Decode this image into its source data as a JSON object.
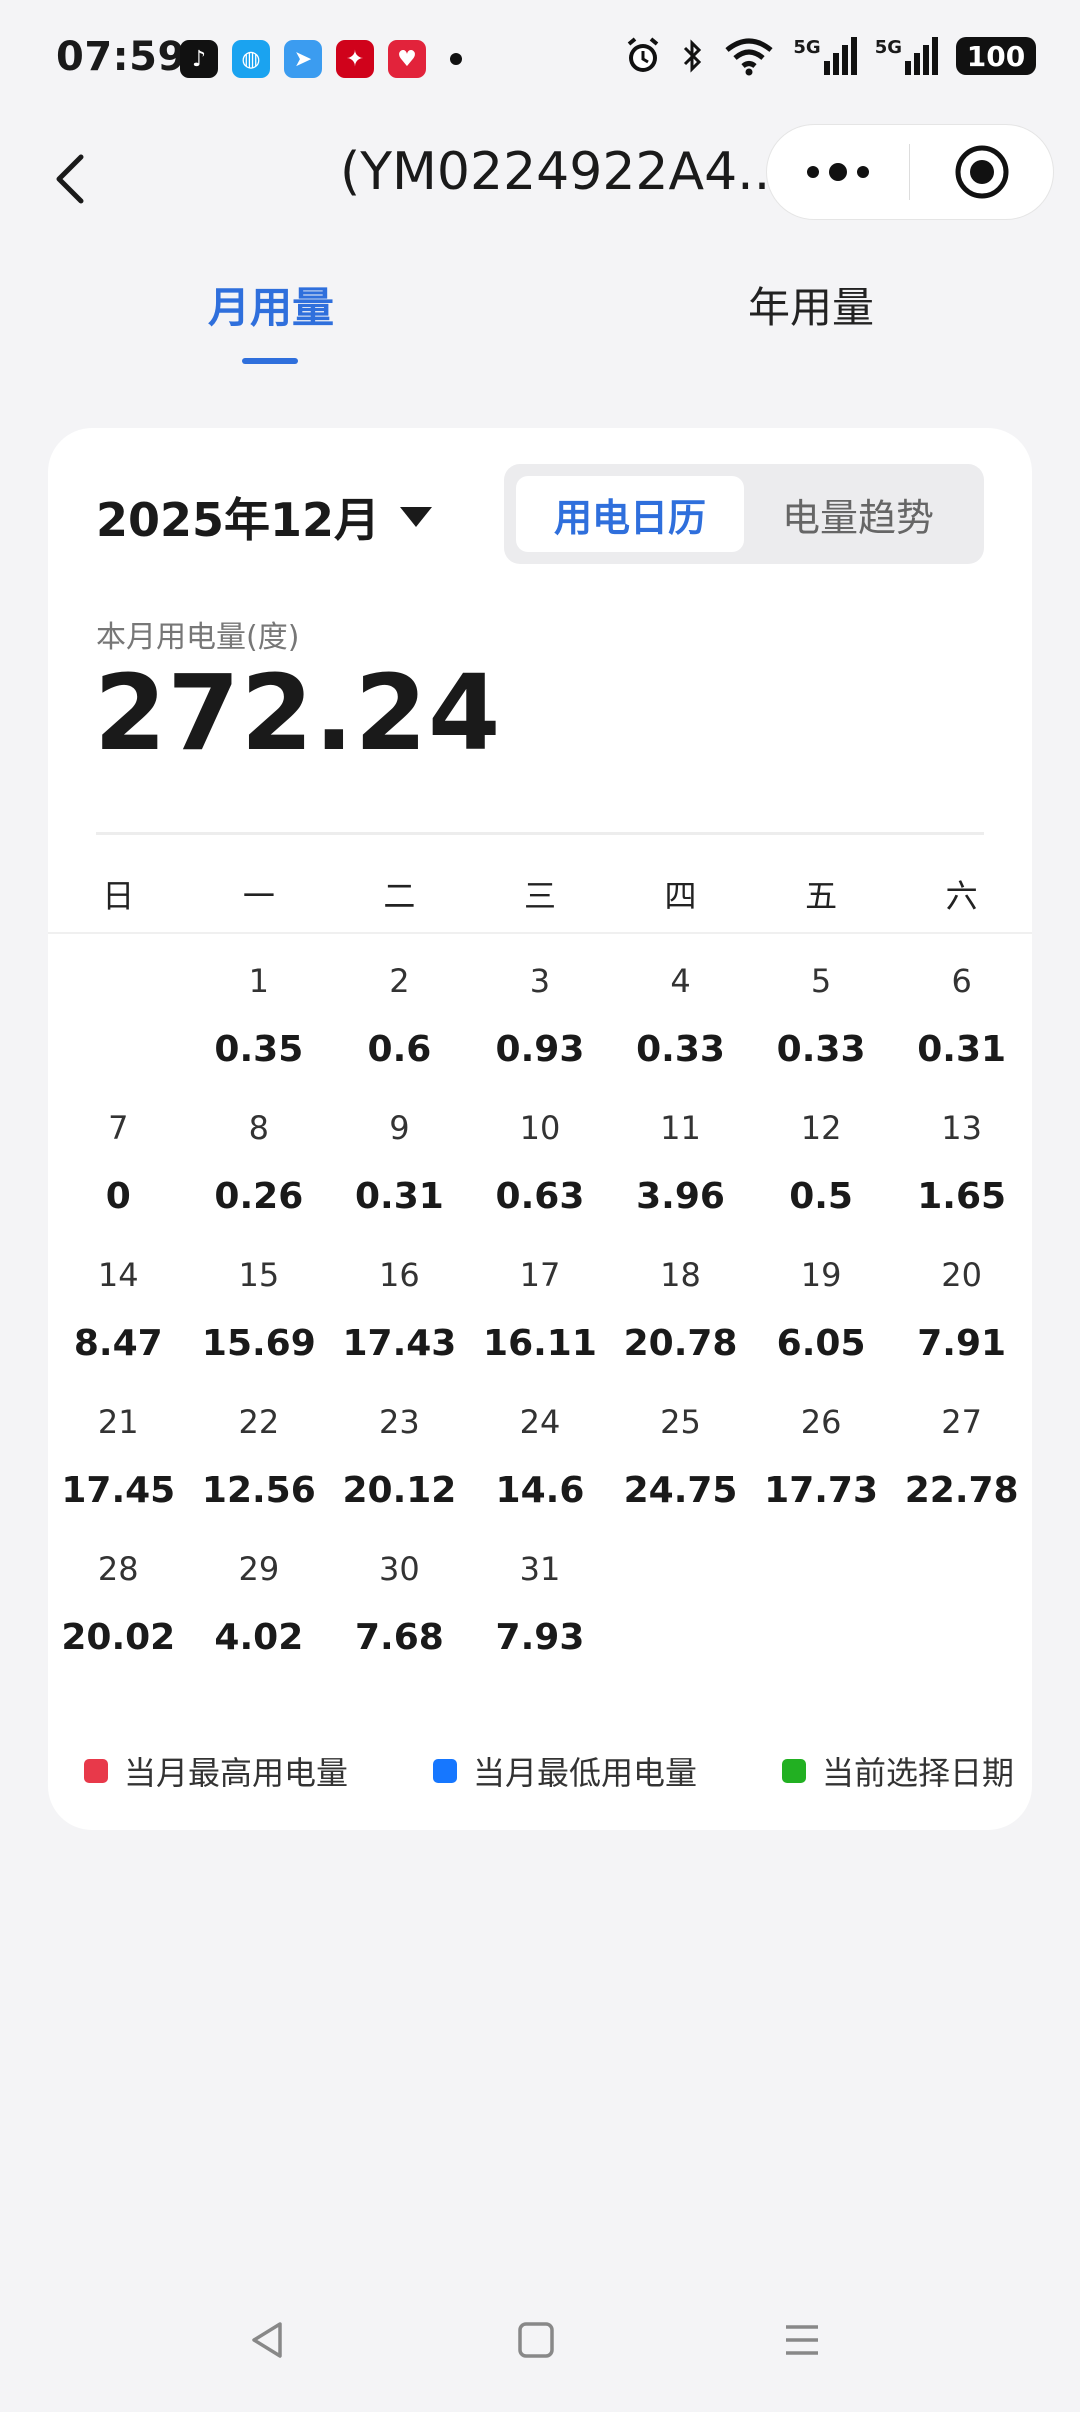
{
  "status_bar": {
    "time": "07:59",
    "battery": "100",
    "signal_label_1": "5G",
    "signal_label_2": "5G"
  },
  "header": {
    "title": "(YM0224922A4...",
    "back_label": "back"
  },
  "tabs": [
    {
      "label": "月用量",
      "active": true
    },
    {
      "label": "年用量",
      "active": false
    }
  ],
  "card": {
    "month": "2025年12月",
    "segments": [
      {
        "label": "用电日历",
        "active": true
      },
      {
        "label": "电量趋势",
        "active": false
      }
    ],
    "usage_label": "本月用电量(度)",
    "usage_value": "272.24"
  },
  "calendar": {
    "weekdays": [
      "日",
      "一",
      "二",
      "三",
      "四",
      "五",
      "六"
    ],
    "weeks": [
      [
        null,
        {
          "day": "1",
          "value": "0.35"
        },
        {
          "day": "2",
          "value": "0.6"
        },
        {
          "day": "3",
          "value": "0.93"
        },
        {
          "day": "4",
          "value": "0.33"
        },
        {
          "day": "5",
          "value": "0.33"
        },
        {
          "day": "6",
          "value": "0.31"
        }
      ],
      [
        {
          "day": "7",
          "value": "0"
        },
        {
          "day": "8",
          "value": "0.26"
        },
        {
          "day": "9",
          "value": "0.31"
        },
        {
          "day": "10",
          "value": "0.63"
        },
        {
          "day": "11",
          "value": "3.96"
        },
        {
          "day": "12",
          "value": "0.5"
        },
        {
          "day": "13",
          "value": "1.65"
        }
      ],
      [
        {
          "day": "14",
          "value": "8.47"
        },
        {
          "day": "15",
          "value": "15.69"
        },
        {
          "day": "16",
          "value": "17.43"
        },
        {
          "day": "17",
          "value": "16.11"
        },
        {
          "day": "18",
          "value": "20.78"
        },
        {
          "day": "19",
          "value": "6.05"
        },
        {
          "day": "20",
          "value": "7.91"
        }
      ],
      [
        {
          "day": "21",
          "value": "17.45"
        },
        {
          "day": "22",
          "value": "12.56"
        },
        {
          "day": "23",
          "value": "20.12"
        },
        {
          "day": "24",
          "value": "14.6"
        },
        {
          "day": "25",
          "value": "24.75"
        },
        {
          "day": "26",
          "value": "17.73"
        },
        {
          "day": "27",
          "value": "22.78"
        }
      ],
      [
        {
          "day": "28",
          "value": "20.02"
        },
        {
          "day": "29",
          "value": "4.02"
        },
        {
          "day": "30",
          "value": "7.68"
        },
        {
          "day": "31",
          "value": "7.93"
        },
        null,
        null,
        null
      ]
    ]
  },
  "legend": [
    {
      "label": "当月最高用电量",
      "color": "#e8394a"
    },
    {
      "label": "当月最低用电量",
      "color": "#1677ff"
    },
    {
      "label": "当前选择日期",
      "color": "#22b022"
    }
  ],
  "colors": {
    "accent": "#2f6fdc"
  }
}
